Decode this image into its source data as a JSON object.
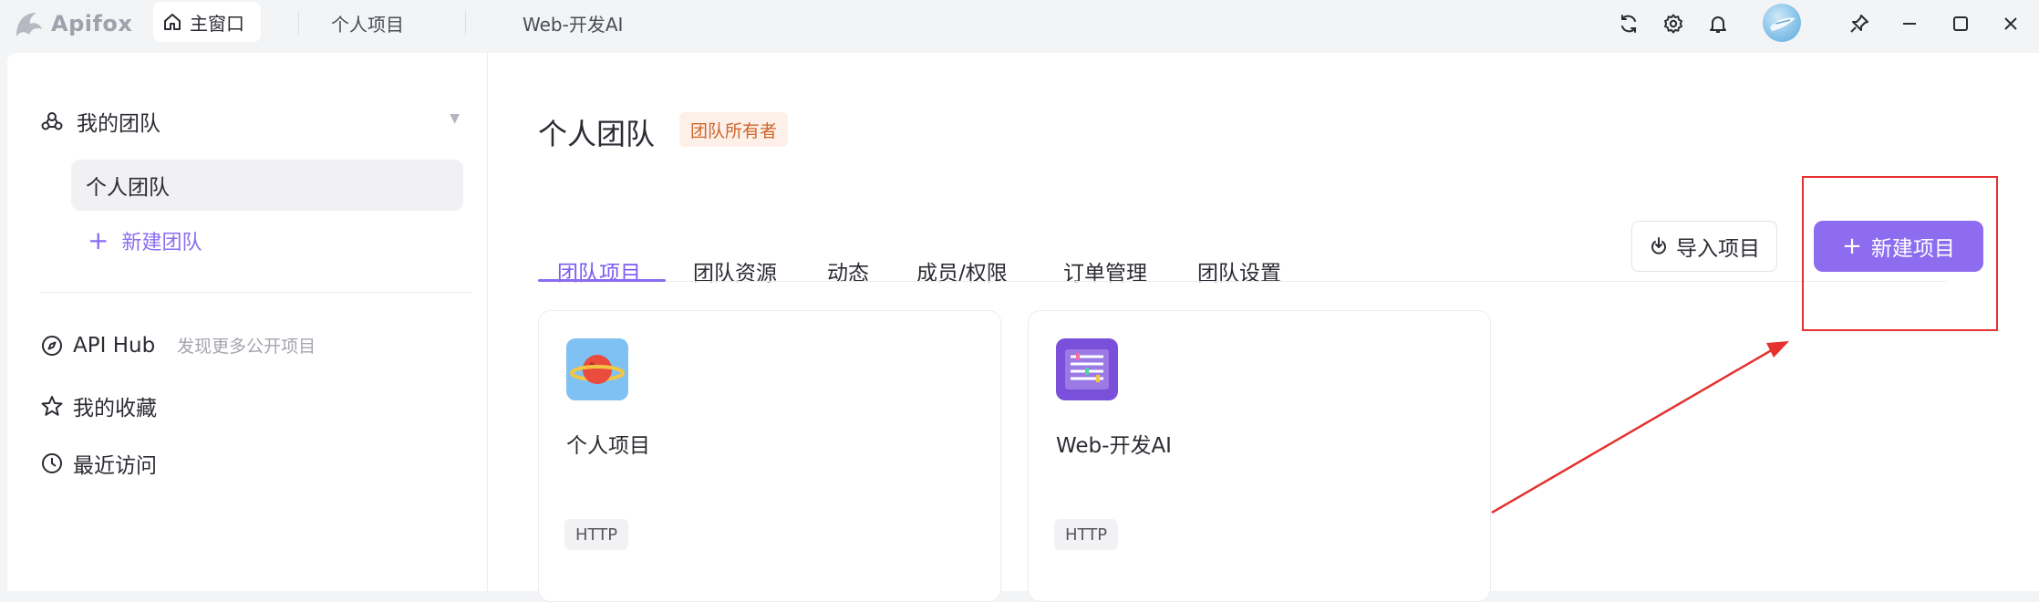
{
  "titlebar": {
    "app_name": "Apifox",
    "tabs": [
      {
        "label": "主窗口"
      },
      {
        "label": "个人项目"
      },
      {
        "label": "Web-开发AI"
      }
    ]
  },
  "sidebar": {
    "team_header": "我的团队",
    "selected_team": "个人团队",
    "new_team": "新建团队",
    "api_hub": {
      "label": "API Hub",
      "hint": "发现更多公开项目"
    },
    "favorites": "我的收藏",
    "recent": "最近访问"
  },
  "main": {
    "title": "个人团队",
    "role_badge": "团队所有者",
    "tabs": [
      {
        "label": "团队项目"
      },
      {
        "label": "团队资源"
      },
      {
        "label": "动态"
      },
      {
        "label": "成员/权限"
      },
      {
        "label": "订单管理"
      },
      {
        "label": "团队设置"
      }
    ],
    "import_button": "导入项目",
    "new_button": "新建项目",
    "projects": [
      {
        "name": "个人项目",
        "type": "HTTP",
        "icon": "planet-icon"
      },
      {
        "name": "Web-开发AI",
        "type": "HTTP",
        "icon": "document-list-icon"
      }
    ]
  },
  "colors": {
    "accent": "#8d6cf0",
    "badge_text": "#d0652b",
    "badge_bg": "#fdf0e9",
    "annotation_red": "#e5312f"
  }
}
